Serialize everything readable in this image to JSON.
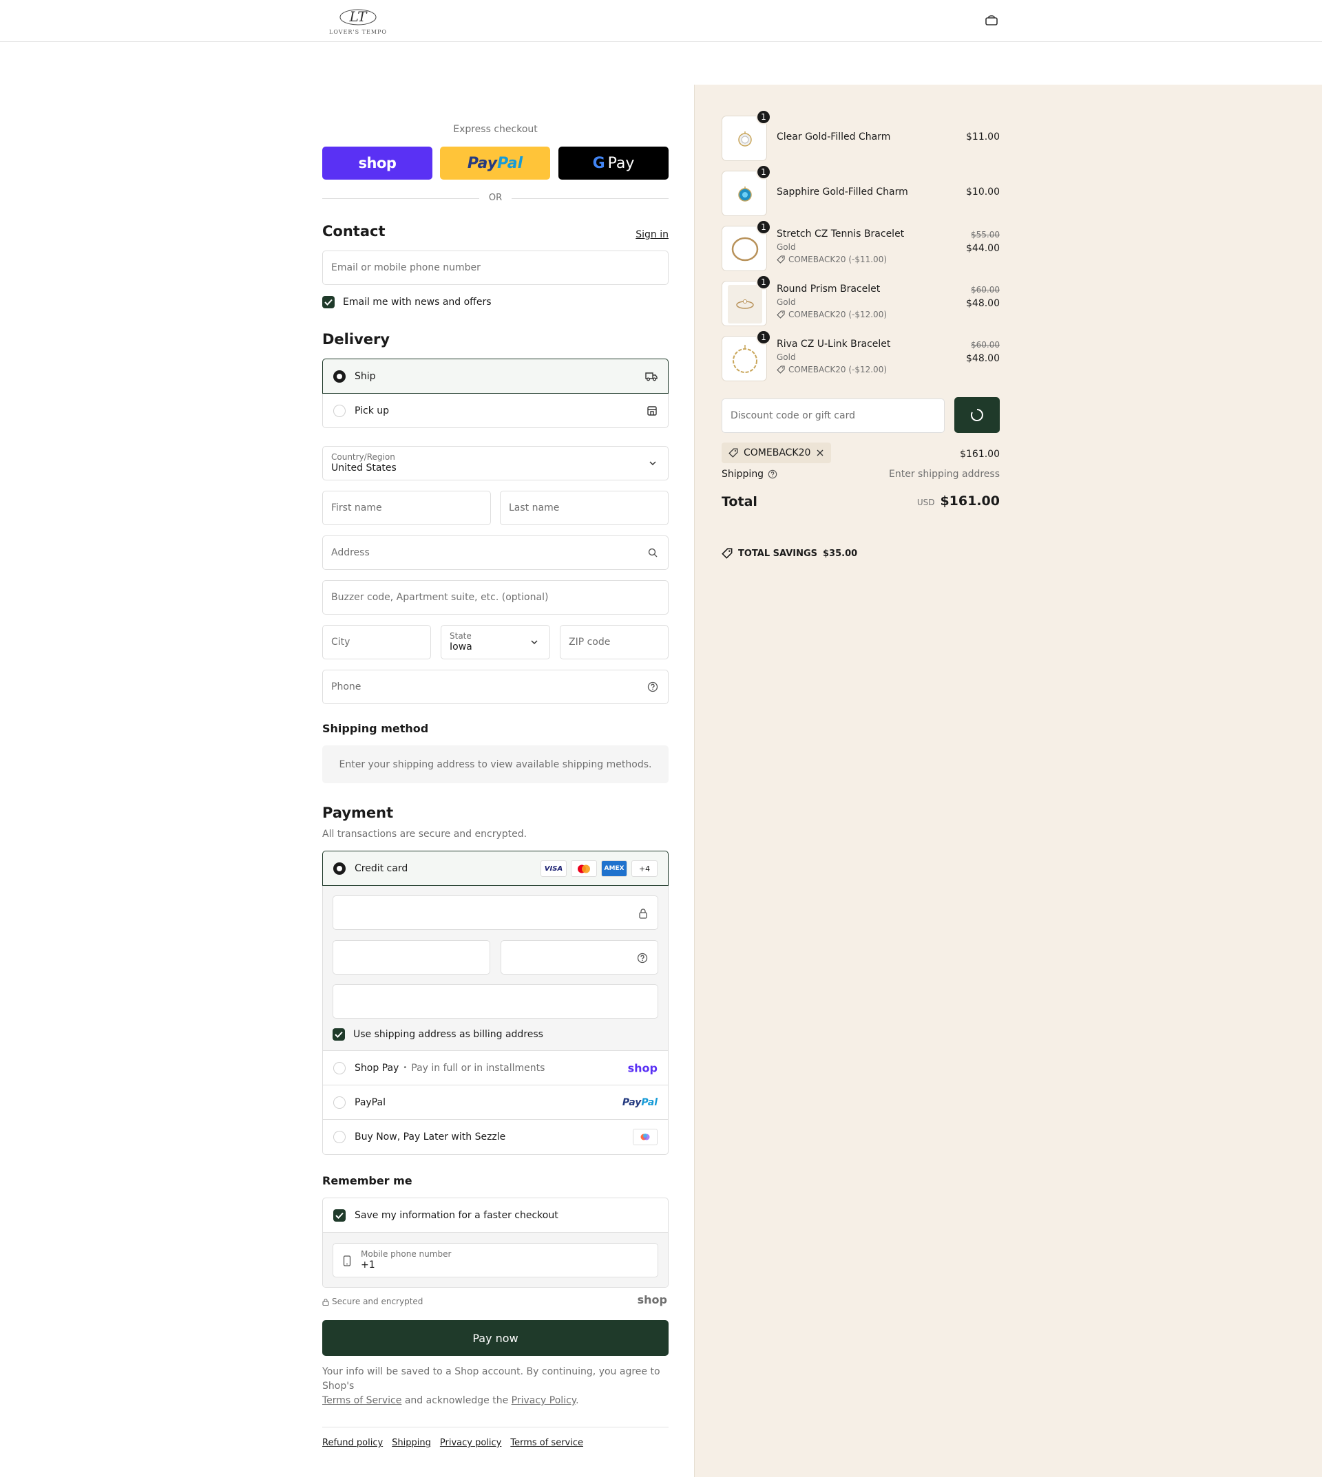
{
  "header": {
    "logo_text": "LOVER'S TEMPO",
    "logo_mark": "LT"
  },
  "express": {
    "label": "Express checkout",
    "shop_label": "shop",
    "paypal_label_a": "Pay",
    "paypal_label_b": "Pal",
    "gpay_g": "G",
    "gpay_label": "Pay",
    "or_label": "OR"
  },
  "contact": {
    "title": "Contact",
    "sign_in": "Sign in",
    "email_placeholder": "Email or mobile phone number",
    "news_label": "Email me with news and offers"
  },
  "delivery": {
    "title": "Delivery",
    "options": [
      {
        "label": "Ship"
      },
      {
        "label": "Pick up"
      }
    ],
    "country_label": "Country/Region",
    "country_value": "United States",
    "first_name": "First name",
    "last_name": "Last name",
    "address": "Address",
    "apartment": "Buzzer code, Apartment suite, etc. (optional)",
    "city": "City",
    "state_label": "State",
    "state_value": "Iowa",
    "zip": "ZIP code",
    "phone": "Phone"
  },
  "shipping_method": {
    "title": "Shipping method",
    "note": "Enter your shipping address to view available shipping methods."
  },
  "payment": {
    "title": "Payment",
    "subtitle": "All transactions are secure and encrypted.",
    "credit_card": "Credit card",
    "cards": [
      "VISA",
      "",
      "AMEX",
      "+4"
    ],
    "billing_same": "Use shipping address as billing address",
    "shop_pay": "Shop Pay",
    "shop_pay_sep": "•",
    "shop_pay_sub": "Pay in full or in installments",
    "shop_pay_logo": "shop",
    "paypal": "PayPal",
    "paypal_logo_a": "Pay",
    "paypal_logo_b": "Pal",
    "sezzle": "Buy Now, Pay Later with Sezzle"
  },
  "remember": {
    "title": "Remember me",
    "save_label": "Save my information for a faster checkout",
    "mobile_label": "Mobile phone number",
    "mobile_value": "+1",
    "secure_label": "Secure and encrypted",
    "shop_logo": "shop"
  },
  "pay_now": "Pay now",
  "legal": {
    "text1": "Your info will be saved to a Shop account. By continuing, you agree to Shop's",
    "terms": "Terms of Service",
    "text2": " and acknowledge the ",
    "privacy": "Privacy Policy",
    "text3": "."
  },
  "footer": [
    "Refund policy",
    "Shipping",
    "Privacy policy",
    "Terms of service"
  ],
  "summary": {
    "items": [
      {
        "qty": "1",
        "name": "Clear Gold-Filled Charm",
        "price": "$11.00"
      },
      {
        "qty": "1",
        "name": "Sapphire Gold-Filled Charm",
        "price": "$10.00"
      },
      {
        "qty": "1",
        "name": "Stretch CZ Tennis Bracelet",
        "variant": "Gold",
        "discount": "COMEBACK20 (-$11.00)",
        "old_price": "$55.00",
        "price": "$44.00"
      },
      {
        "qty": "1",
        "name": "Round Prism Bracelet",
        "variant": "Gold",
        "discount": "COMEBACK20 (-$12.00)",
        "old_price": "$60.00",
        "price": "$48.00"
      },
      {
        "qty": "1",
        "name": "Riva CZ U-Link Bracelet",
        "variant": "Gold",
        "discount": "COMEBACK20 (-$12.00)",
        "old_price": "$60.00",
        "price": "$48.00"
      }
    ],
    "discount_placeholder": "Discount code or gift card",
    "chip": "COMEBACK20",
    "subtotal_value": "$161.00",
    "shipping_label": "Shipping",
    "shipping_value": "Enter shipping address",
    "total_label": "Total",
    "currency": "USD",
    "total_value": "$161.00",
    "savings_label": "TOTAL SAVINGS",
    "savings_value": "$35.00"
  }
}
